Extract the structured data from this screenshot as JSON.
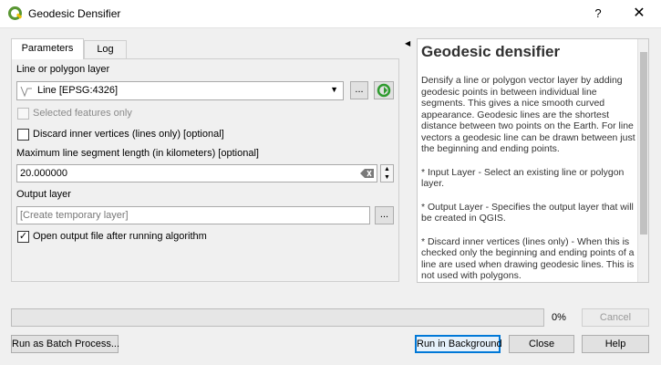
{
  "window": {
    "title": "Geodesic Densifier",
    "help_glyph": "?",
    "close_glyph": "✕"
  },
  "tabs": [
    {
      "label": "Parameters",
      "active": true
    },
    {
      "label": "Log",
      "active": false
    }
  ],
  "form": {
    "layer_label": "Line or polygon layer",
    "layer_value": "Line [EPSG:4326]",
    "ellipsis": "...",
    "selected_only_label": "Selected features only",
    "discard_label": "Discard inner vertices (lines only) [optional]",
    "max_len_label": "Maximum line segment length (in kilometers) [optional]",
    "max_len_value": "20.000000",
    "output_label": "Output layer",
    "output_placeholder": "[Create temporary layer]",
    "open_output_label": "Open output file after running algorithm",
    "open_output_checked": true
  },
  "help": {
    "title": "Geodesic densifier",
    "paragraphs": [
      "Densify a line or polygon vector layer by adding geodesic points in between individual line segments. This gives a nice smooth curved appearance. Geodesic lines are the shortest distance between two points on the Earth. For line vectors a geodesic line can be drawn between just the beginning and ending points.",
      "* Input Layer - Select an existing line or polygon layer.",
      "* Output Layer - Specifies the output layer that will be created in QGIS.",
      "* Discard inner vertices (lines only) - When this is checked only the beginning and ending points of a line are used when drawing geodesic lines. This is not used with polygons."
    ]
  },
  "progress": {
    "percent_text": "0%",
    "value": 0
  },
  "buttons": {
    "cancel": "Cancel",
    "batch": "Run as Batch Process...",
    "run_bg": "Run in Background",
    "close": "Close",
    "help": "Help"
  },
  "colors": {
    "accent": "#0078d7",
    "qgis_green": "#589632"
  },
  "icons": {
    "app": "qgis-logo-icon",
    "layer": "line-layer-icon",
    "iterate": "iterate-green-icon",
    "clear": "clear-field-icon"
  }
}
